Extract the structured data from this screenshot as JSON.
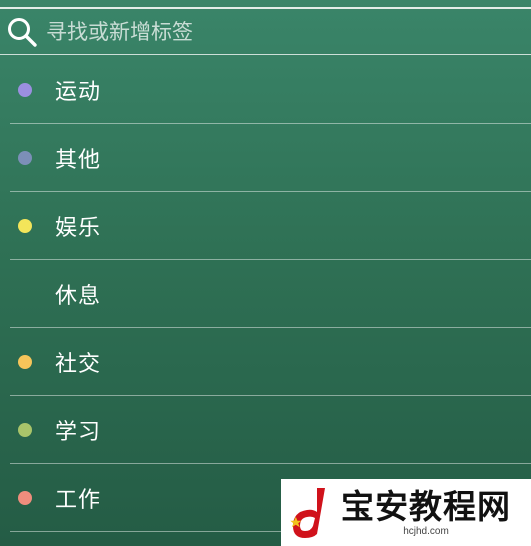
{
  "search": {
    "placeholder": "寻找或新增标签",
    "icon": "search-icon"
  },
  "tags": [
    {
      "label": "运动",
      "color": "#9b8fe0"
    },
    {
      "label": "其他",
      "color": "#7c8fb8"
    },
    {
      "label": "娱乐",
      "color": "#f3e55a"
    },
    {
      "label": "休息",
      "color": ""
    },
    {
      "label": "社交",
      "color": "#f6c55a"
    },
    {
      "label": "学习",
      "color": "#a9c46a"
    },
    {
      "label": "工作",
      "color": "#ef8d7d"
    }
  ],
  "watermark": {
    "title": "宝安教程网",
    "domain": "hcjhd.com"
  }
}
